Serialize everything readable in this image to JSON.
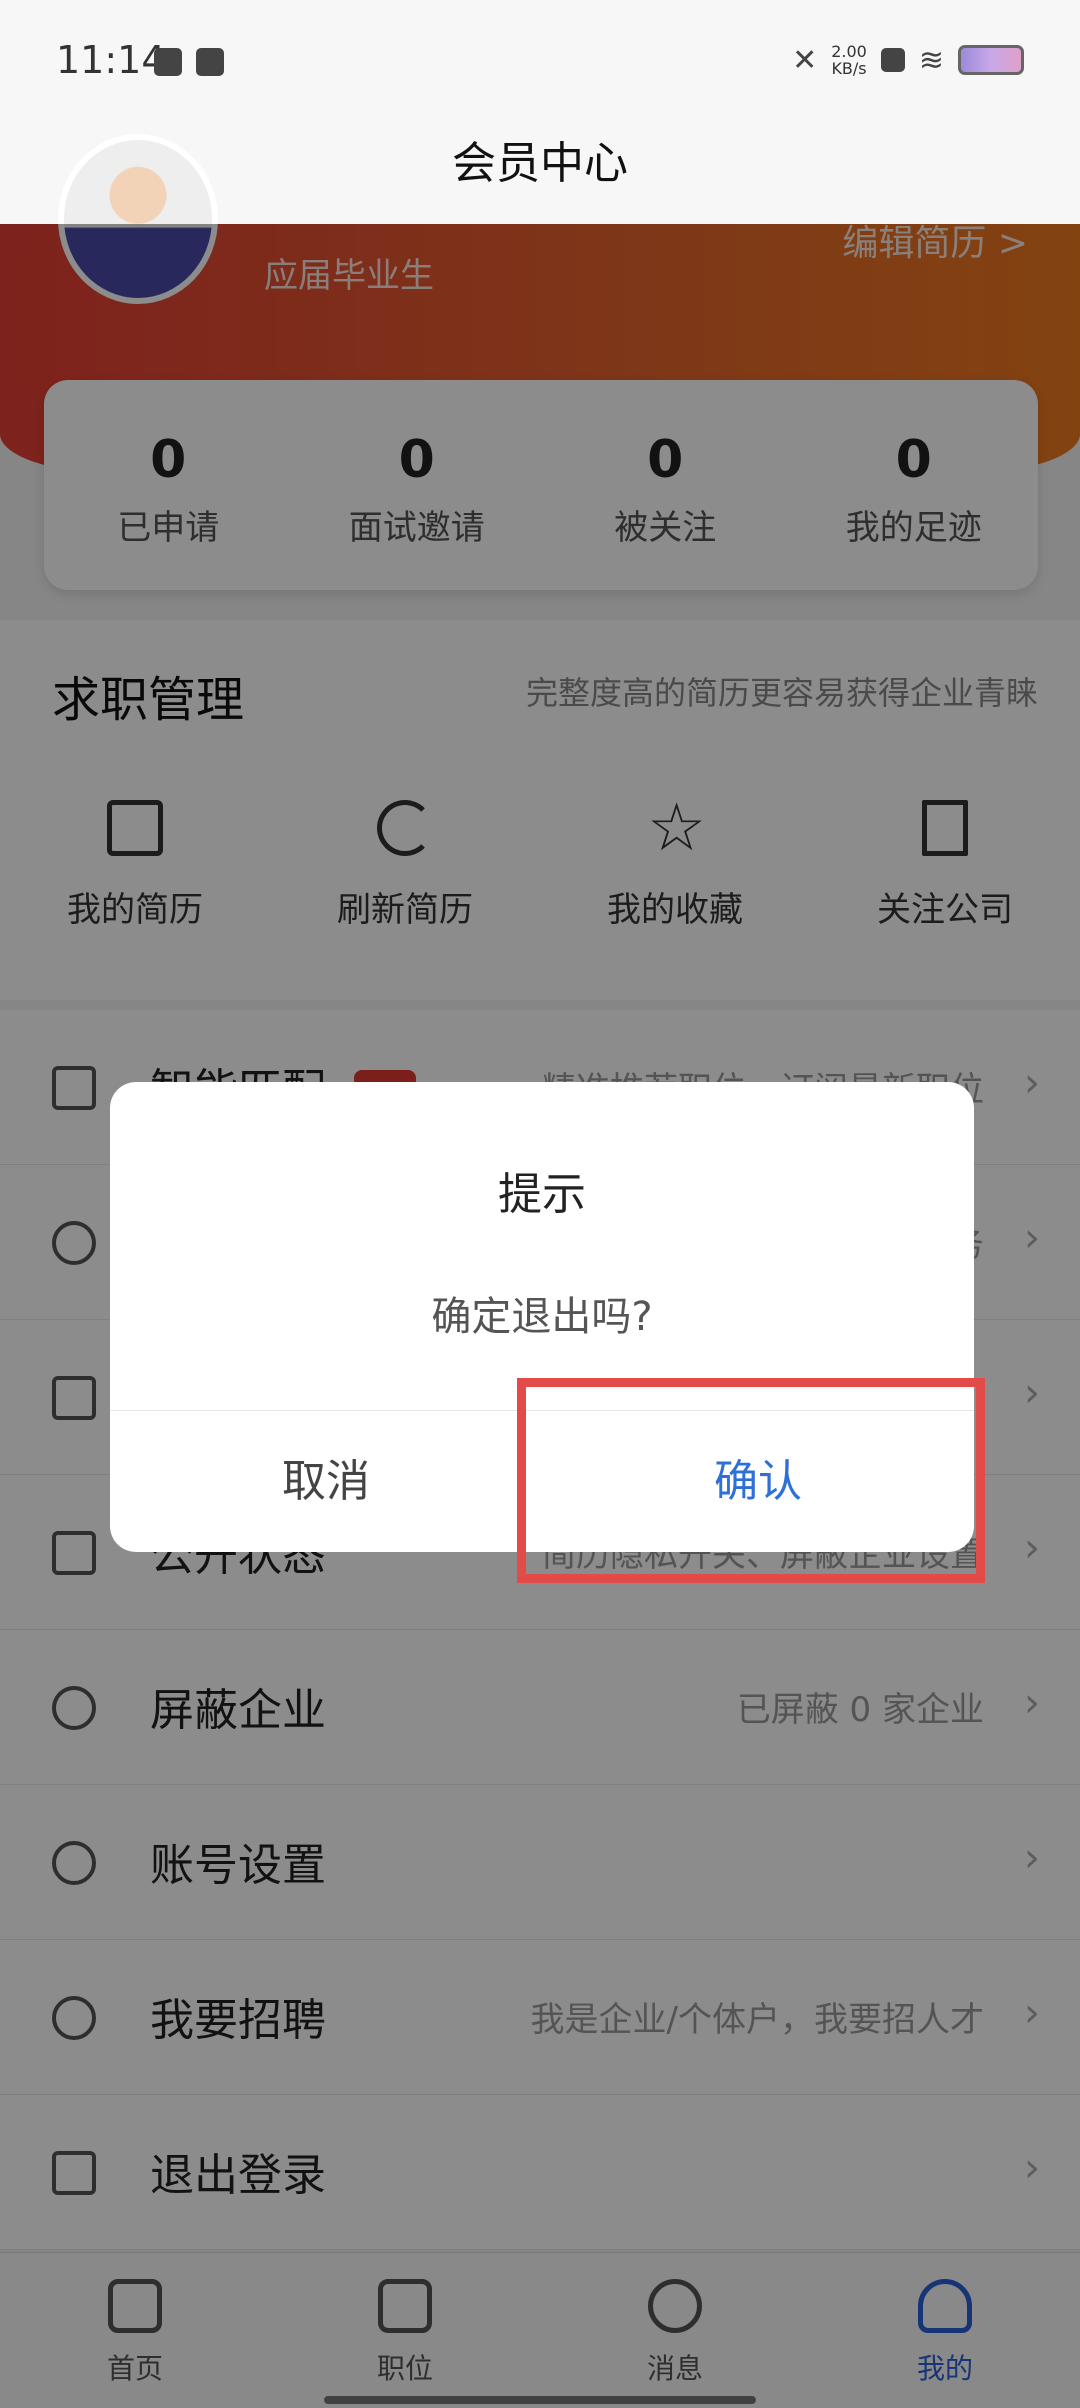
{
  "status_bar": {
    "time": "11:14",
    "net_speed_value": "2.00",
    "net_speed_unit": "KB/s"
  },
  "nav": {
    "title": "会员中心"
  },
  "header": {
    "subtitle": "应届毕业生",
    "edit_resume": "编辑简历 >"
  },
  "stats": [
    {
      "value": "0",
      "label": "已申请"
    },
    {
      "value": "0",
      "label": "面试邀请"
    },
    {
      "value": "0",
      "label": "被关注"
    },
    {
      "value": "0",
      "label": "我的足迹"
    }
  ],
  "job_management": {
    "title": "求职管理",
    "hint": "完整度高的简历更容易获得企业青睐",
    "items": [
      {
        "label": "我的简历",
        "icon": "resume-icon"
      },
      {
        "label": "刷新简历",
        "icon": "refresh-icon"
      },
      {
        "label": "我的收藏",
        "icon": "star-icon"
      },
      {
        "label": "关注公司",
        "icon": "building-icon"
      }
    ]
  },
  "menu": [
    {
      "label": "智能匹配",
      "desc": "精准推荐职位，订阅最新职位",
      "icon": "hourglass-icon"
    },
    {
      "label": "",
      "desc": "务",
      "icon": "crown-icon"
    },
    {
      "label": "",
      "desc": "",
      "icon": "wallet-icon"
    },
    {
      "label": "公开状态",
      "desc": "简历隐私开关、屏蔽企业设置",
      "icon": "lock-icon"
    },
    {
      "label": "屏蔽企业",
      "desc": "已屏蔽 0 家企业",
      "icon": "block-icon"
    },
    {
      "label": "账号设置",
      "desc": "",
      "icon": "hexagon-settings-icon"
    },
    {
      "label": "我要招聘",
      "desc": "我是企业/个体户，我要招人才",
      "icon": "recruit-icon"
    },
    {
      "label": "退出登录",
      "desc": "",
      "icon": "logout-icon"
    }
  ],
  "tabs": [
    {
      "label": "首页",
      "icon": "home-icon"
    },
    {
      "label": "职位",
      "icon": "briefcase-icon"
    },
    {
      "label": "消息",
      "icon": "chat-icon"
    },
    {
      "label": "我的",
      "icon": "person-icon"
    }
  ],
  "dialog": {
    "title": "提示",
    "message": "确定退出吗?",
    "cancel_label": "取消",
    "confirm_label": "确认"
  },
  "colors": {
    "accent_red": "#e53e35",
    "accent_orange": "#ef7a20",
    "link_blue": "#2f6fd8",
    "highlight_red": "#e24b48"
  }
}
